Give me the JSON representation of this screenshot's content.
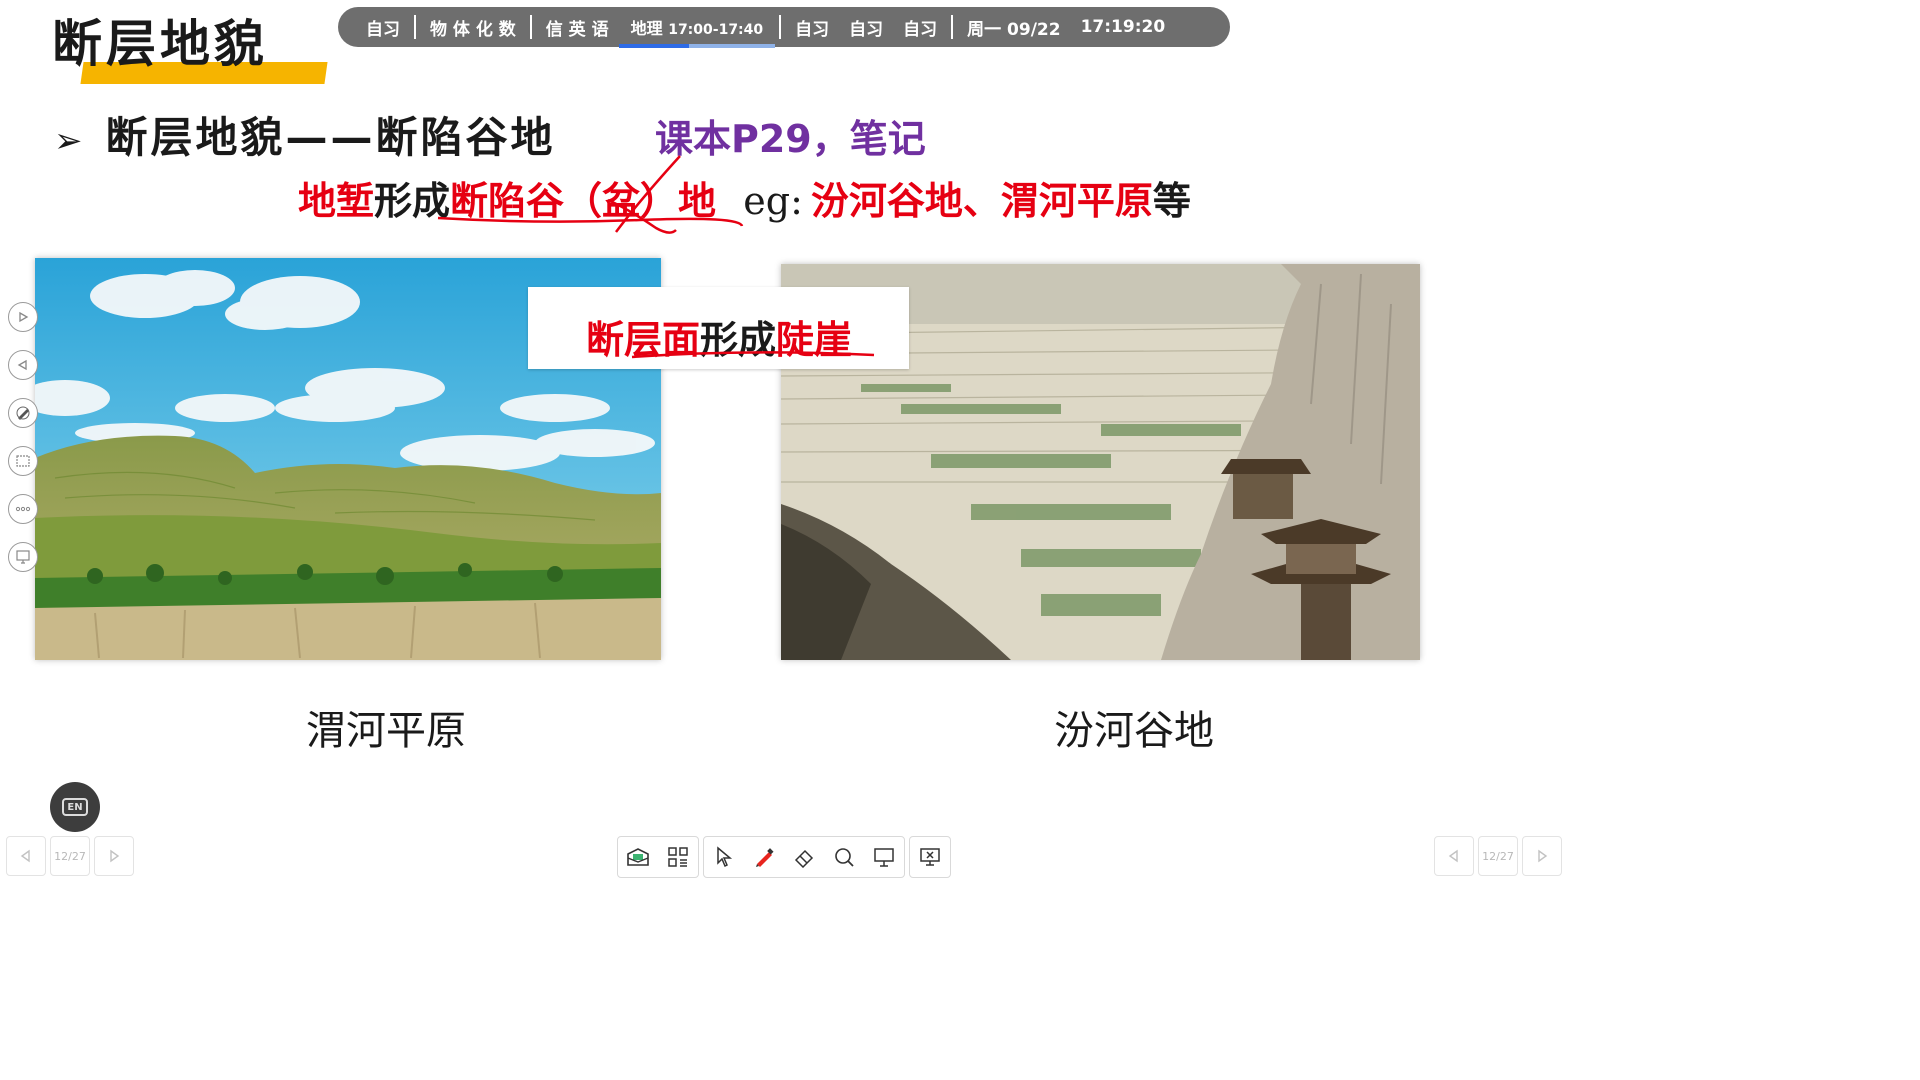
{
  "title": "断层地貌",
  "schedule": {
    "items": [
      "自习",
      "物 体 化 数",
      "信 英 语"
    ],
    "current": {
      "subject": "地理",
      "time": "17:00-17:40",
      "progress": 0.45
    },
    "after": [
      "自习",
      "自习",
      "自习"
    ],
    "date": "周一 09/22",
    "clock": "17:19:20"
  },
  "heading": {
    "arrow": "➢",
    "text": "断层地貌——断陷谷地",
    "note": "课本P29，笔记"
  },
  "line2": {
    "p1": "地堑",
    "p2": "形成",
    "p3": "断陷谷（盆）地",
    "p4": "eg:",
    "p5": "汾河谷地、渭河平原",
    "p6": "等"
  },
  "callout": {
    "p1": "断层面",
    "p2": "形成",
    "p3": "陡崖"
  },
  "captions": {
    "left": "渭河平原",
    "right": "汾河谷地"
  },
  "pagenav": {
    "left_count": "12/27",
    "right_count": "12/27"
  },
  "lang_button": "EN",
  "icons": {
    "side": [
      "play-icon",
      "back-icon",
      "pen-settings-icon",
      "screenshot-icon",
      "more-icon",
      "screen-icon"
    ],
    "toolbar": [
      "box-icon",
      "apps-icon",
      "pointer-icon",
      "pen-icon",
      "eraser-icon",
      "search-icon",
      "whiteboard-icon",
      "exit-icon"
    ]
  },
  "colors": {
    "accent_red": "#e60012",
    "note_purple": "#7030a0",
    "title_bar": "#f6b400"
  }
}
